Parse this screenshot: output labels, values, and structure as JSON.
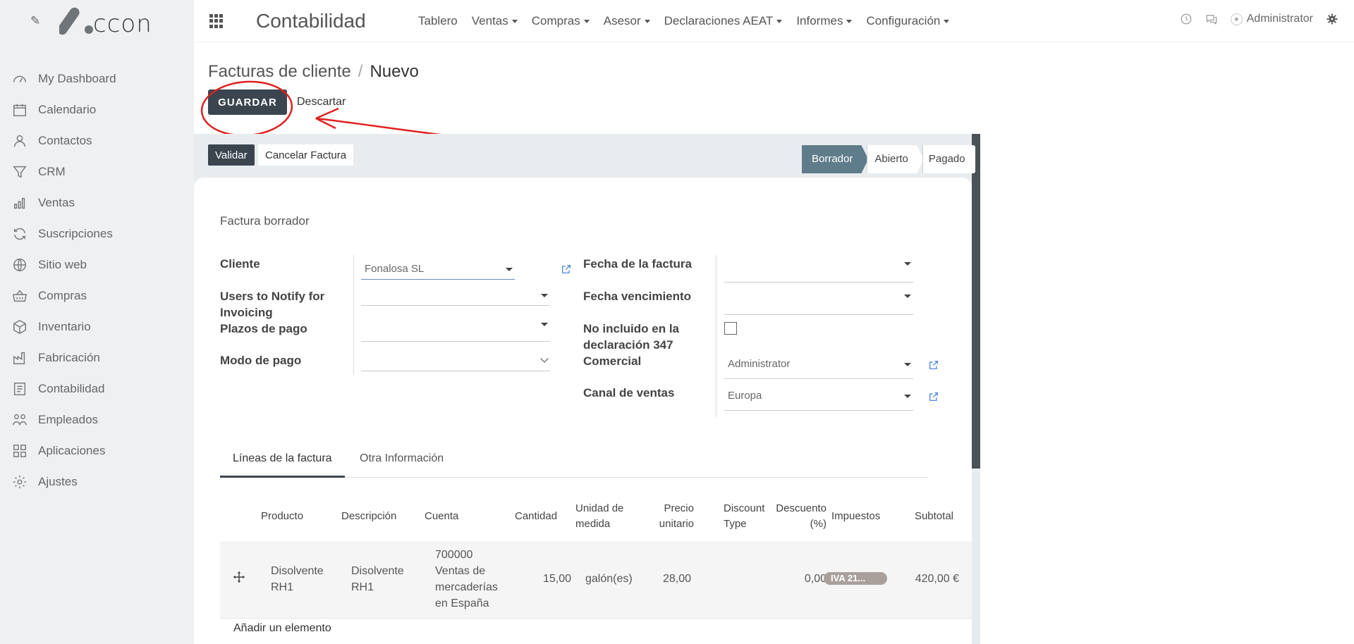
{
  "brand": {
    "logo_text": "ccon"
  },
  "sidebar": {
    "items": [
      {
        "label": "My Dashboard",
        "icon": "gauge-icon"
      },
      {
        "label": "Calendario",
        "icon": "calendar-icon"
      },
      {
        "label": "Contactos",
        "icon": "user-icon"
      },
      {
        "label": "CRM",
        "icon": "funnel-icon"
      },
      {
        "label": "Ventas",
        "icon": "bar-chart-icon"
      },
      {
        "label": "Suscripciones",
        "icon": "refresh-icon"
      },
      {
        "label": "Sitio web",
        "icon": "globe-icon"
      },
      {
        "label": "Compras",
        "icon": "basket-icon"
      },
      {
        "label": "Inventario",
        "icon": "box-icon"
      },
      {
        "label": "Fabricación",
        "icon": "factory-icon"
      },
      {
        "label": "Contabilidad",
        "icon": "invoice-icon"
      },
      {
        "label": "Empleados",
        "icon": "people-icon"
      },
      {
        "label": "Aplicaciones",
        "icon": "grid-icon"
      },
      {
        "label": "Ajustes",
        "icon": "gear-icon"
      }
    ]
  },
  "topbar": {
    "app_title": "Contabilidad",
    "menu": [
      {
        "label": "Tablero",
        "dropdown": false
      },
      {
        "label": "Ventas",
        "dropdown": true
      },
      {
        "label": "Compras",
        "dropdown": true
      },
      {
        "label": "Asesor",
        "dropdown": true
      },
      {
        "label": "Declaraciones AEAT",
        "dropdown": true
      },
      {
        "label": "Informes",
        "dropdown": true
      },
      {
        "label": "Configuración",
        "dropdown": true
      }
    ],
    "user": "Administrator"
  },
  "control": {
    "breadcrumb_parent": "Facturas de cliente",
    "breadcrumb_current": "Nuevo",
    "save_label": "GUARDAR",
    "discard_label": "Descartar"
  },
  "statusbar": {
    "validate_label": "Validar",
    "cancel_label": "Cancelar Factura",
    "steps": [
      "Borrador",
      "Abierto",
      "Pagado"
    ],
    "active_step": "Borrador"
  },
  "form": {
    "draft_label": "Factura borrador",
    "left": {
      "cliente_label": "Cliente",
      "cliente_value": "Fonalosa SL",
      "notify_label": "Users to Notify for Invoicing",
      "notify_value": "",
      "plazos_label": "Plazos de pago",
      "plazos_value": "",
      "modo_label": "Modo de pago",
      "modo_value": ""
    },
    "right": {
      "fecha_label": "Fecha de la factura",
      "fecha_value": "",
      "vencimiento_label": "Fecha vencimiento",
      "vencimiento_value": "",
      "no347_label": "No incluido en la declaración 347",
      "no347_checked": false,
      "comercial_label": "Comercial",
      "comercial_value": "Administrator",
      "canal_label": "Canal de ventas",
      "canal_value": "Europa"
    }
  },
  "tabs": [
    {
      "label": "Líneas de la factura",
      "active": true
    },
    {
      "label": "Otra Información",
      "active": false
    }
  ],
  "lines": {
    "headers": {
      "producto": "Producto",
      "descripcion": "Descripción",
      "cuenta": "Cuenta",
      "cantidad": "Cantidad",
      "unidad": "Unidad de medida",
      "precio": "Precio unitario",
      "discount_type": "Discount Type",
      "descuento": "Descuento (%)",
      "impuestos": "Impuestos",
      "subtotal": "Subtotal"
    },
    "rows": [
      {
        "producto": "Disolvente RH1",
        "descripcion": "Disolvente RH1",
        "cuenta": "700000 Ventas de mercaderías en España",
        "cantidad": "15,00",
        "unidad": "galón(es)",
        "precio": "28,00",
        "discount_type": "",
        "descuento": "0,00",
        "impuestos": "IVA 21...",
        "subtotal": "420,00 €"
      }
    ],
    "add_label": "Añadir un elemento"
  }
}
